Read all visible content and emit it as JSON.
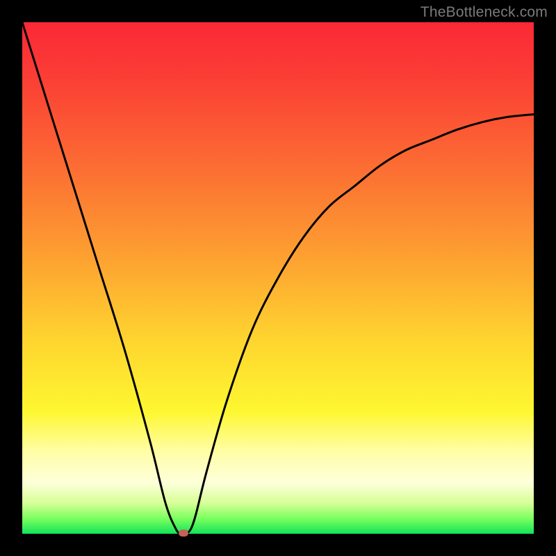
{
  "watermark": "TheBottleneck.com",
  "colors": {
    "background": "#000000",
    "gradient_top": "#fb2836",
    "gradient_bottom": "#12e459",
    "curve": "#000000",
    "marker": "#c76058",
    "watermark_text": "#7b7b7b"
  },
  "chart_data": {
    "type": "line",
    "title": "",
    "xlabel": "",
    "ylabel": "",
    "xlim": [
      0,
      100
    ],
    "ylim": [
      0,
      100
    ],
    "series": [
      {
        "name": "bottleneck-curve",
        "x": [
          0,
          5,
          10,
          15,
          20,
          25,
          28,
          30,
          31,
          32,
          33,
          34,
          36,
          40,
          45,
          50,
          55,
          60,
          65,
          70,
          75,
          80,
          85,
          90,
          95,
          100
        ],
        "y": [
          100,
          84,
          68,
          52,
          36,
          18,
          6,
          1,
          0,
          0,
          1,
          4,
          12,
          26,
          40,
          50,
          58,
          64,
          68,
          72,
          75,
          77,
          79,
          80.5,
          81.5,
          82
        ]
      }
    ],
    "marker": {
      "x": 31.5,
      "y": 0,
      "label": "optimal-point"
    },
    "grid": false,
    "legend": false
  }
}
